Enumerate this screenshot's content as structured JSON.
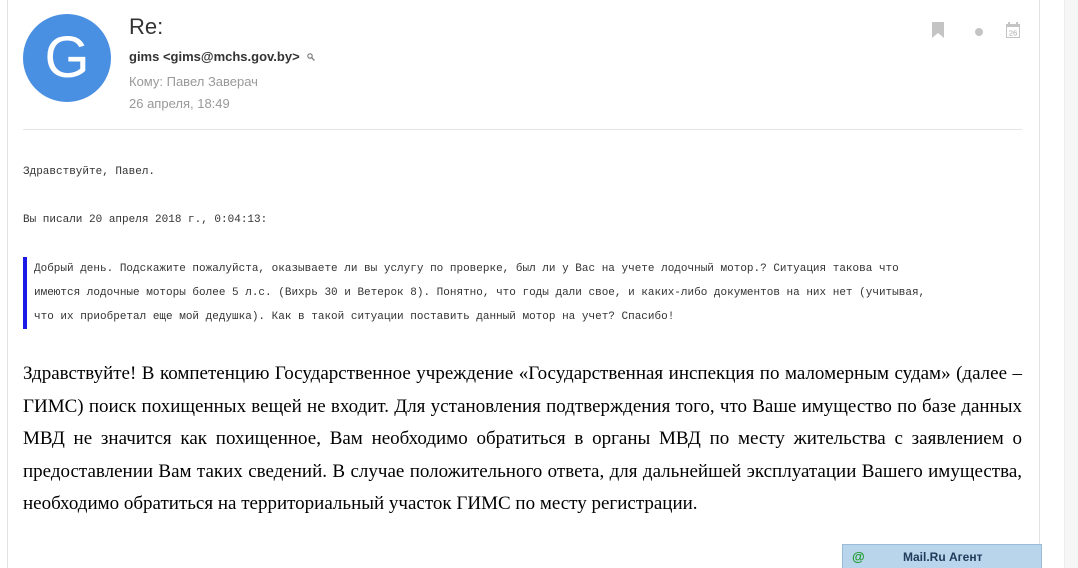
{
  "email": {
    "avatar_letter": "G",
    "avatar_color": "#4a90e2",
    "subject": "Re:",
    "sender": "gims <gims@mchs.gov.by>",
    "recipient": "Кому: Павел Заверач",
    "date": "26 апреля, 18:49",
    "calendar_day": "26"
  },
  "body": {
    "greeting": "Здравствуйте, Павел.",
    "wrote": "Вы писали 20 апреля 2018 г., 0:04:13:",
    "quote_lines": [
      "Добрый день. Подскажите пожалуйста, оказываете ли вы услугу по проверке, был ли у Вас на учете лодочный мотор.? Ситуация такова что",
      "имеются лодочные моторы более 5 л.с. (Вихрь 30 и Ветерок 8). Понятно, что годы дали свое, и каких-либо документов на них нет (учитывая,",
      "что их приобретал еще мой дедушка). Как в такой ситуации поставить данный мотор на учет? Спасибо!"
    ],
    "reply_text": "Здравствуйте! В компетенцию Государственное учреждение «Государственная инспекция по маломерным судам» (далее – ГИМС) поиск похищенных вещей не входит. Для установления подтверждения того, что Ваше имущество по базе данных МВД не значится как похищенное, Вам необходимо обратиться в органы МВД по месту жительства с заявлением о предоставлении Вам таких сведений. В случае положительного ответа, для дальнейшей эксплуатации Вашего имущества, необходимо обратиться на территориальный участок ГИМС по месту регистрации."
  },
  "agent_bar": {
    "icon": "@",
    "label": "Mail.Ru Агент"
  },
  "colors": {
    "quote_bar": "#1a1ae6",
    "agent_bg": "#b9d5eb"
  }
}
